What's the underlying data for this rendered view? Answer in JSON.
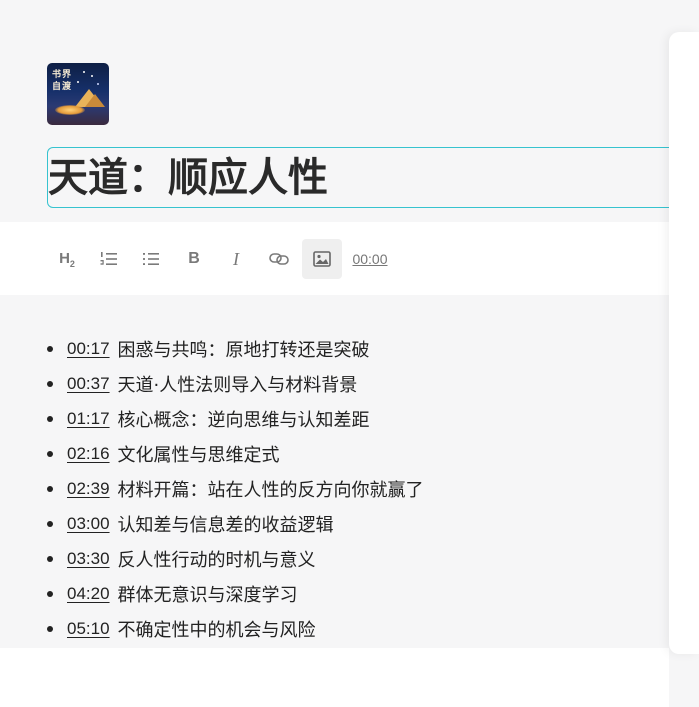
{
  "cover": {
    "title_text": "书界自渡"
  },
  "document": {
    "title": "天道：顺应人性"
  },
  "toolbar": {
    "timestamp_label": "00:00",
    "tools": [
      {
        "name": "heading-2",
        "icon": "heading-2-icon"
      },
      {
        "name": "ordered-list",
        "icon": "ordered-list-icon"
      },
      {
        "name": "bullet-list",
        "icon": "bullet-list-icon"
      },
      {
        "name": "bold",
        "icon": "bold-icon"
      },
      {
        "name": "italic",
        "icon": "italic-icon"
      },
      {
        "name": "link",
        "icon": "link-icon"
      },
      {
        "name": "image",
        "icon": "image-icon",
        "active": true
      },
      {
        "name": "timestamp",
        "icon": "timestamp-icon"
      }
    ]
  },
  "outline": {
    "items": [
      {
        "time": "00:17",
        "text": "困惑与共鸣：原地打转还是突破"
      },
      {
        "time": "00:37",
        "text": "天道·人性法则导入与材料背景"
      },
      {
        "time": "01:17",
        "text": "核心概念：逆向思维与认知差距"
      },
      {
        "time": "02:16",
        "text": "文化属性与思维定式"
      },
      {
        "time": "02:39",
        "text": "材料开篇：站在人性的反方向你就赢了"
      },
      {
        "time": "03:00",
        "text": "认知差与信息差的收益逻辑"
      },
      {
        "time": "03:30",
        "text": "反人性行动的时机与意义"
      },
      {
        "time": "04:20",
        "text": "群体无意识与深度学习"
      },
      {
        "time": "05:10",
        "text": "不确定性中的机会与风险"
      }
    ]
  },
  "colors": {
    "accent_border": "#36c3cf",
    "text": "#222222",
    "toolbar_icon": "#777777"
  }
}
